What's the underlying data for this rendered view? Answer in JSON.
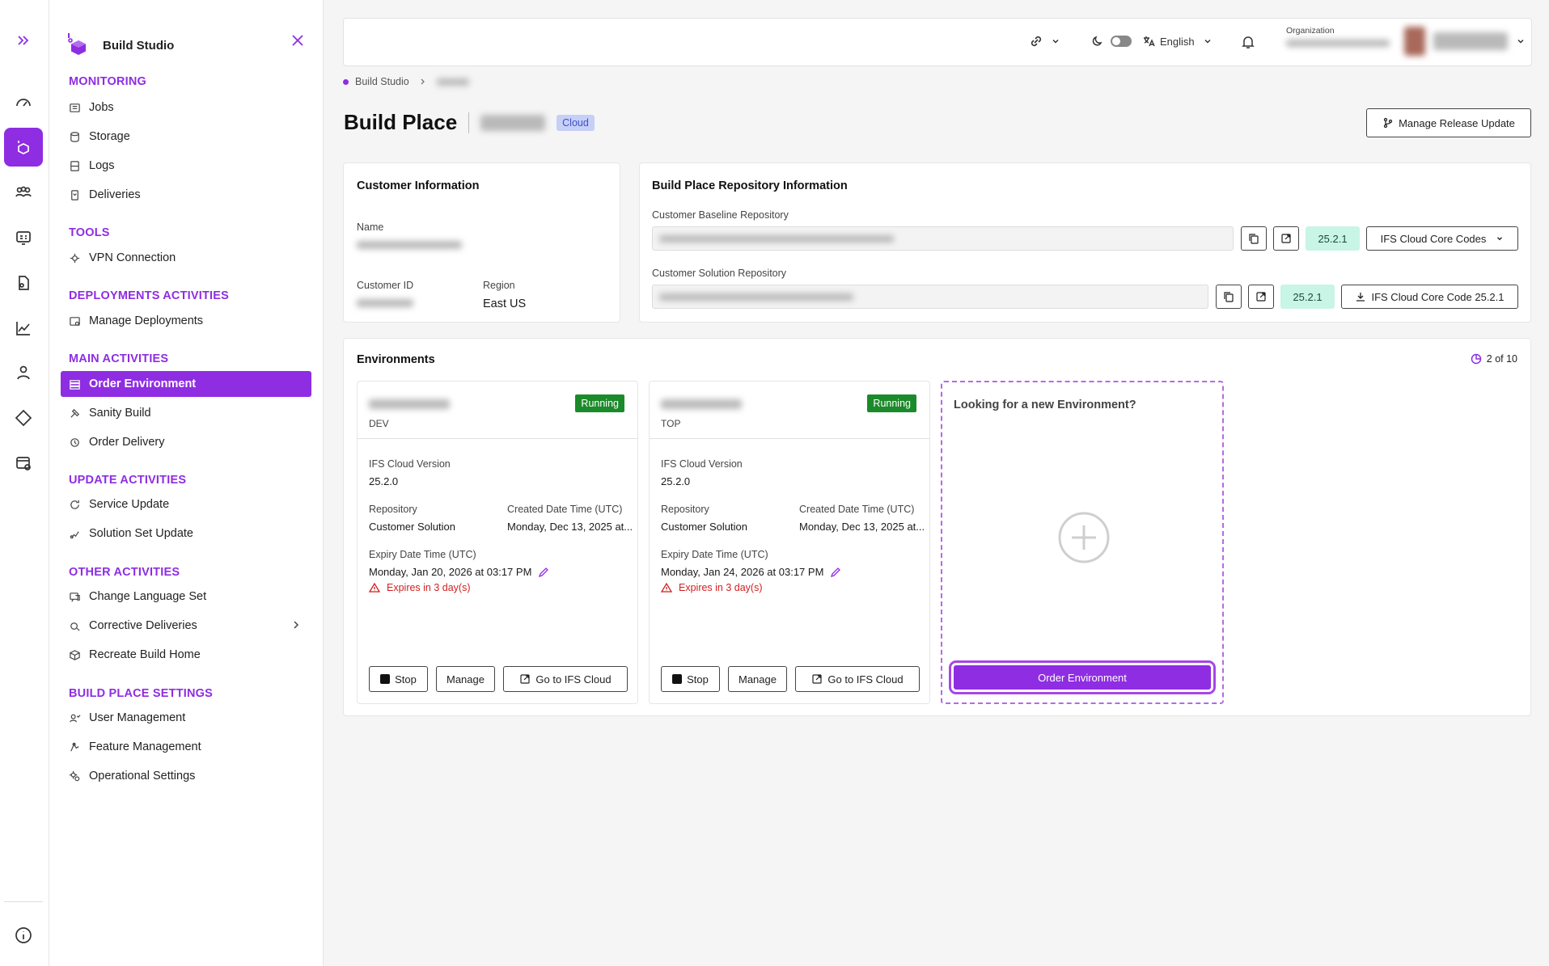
{
  "brand": {
    "title": "Build Studio"
  },
  "sidebar": {
    "sections": [
      {
        "title": "MONITORING",
        "items": [
          "Jobs",
          "Storage",
          "Logs",
          "Deliveries"
        ]
      },
      {
        "title": "TOOLS",
        "items": [
          "VPN Connection"
        ]
      },
      {
        "title": "DEPLOYMENTS ACTIVITIES",
        "items": [
          "Manage Deployments"
        ]
      },
      {
        "title": "MAIN ACTIVITIES",
        "items": [
          "Order Environment",
          "Sanity Build",
          "Order Delivery"
        ]
      },
      {
        "title": "UPDATE ACTIVITIES",
        "items": [
          "Service Update",
          "Solution Set Update"
        ]
      },
      {
        "title": "OTHER ACTIVITIES",
        "items": [
          "Change Language Set",
          "Corrective Deliveries",
          "Recreate Build Home"
        ]
      },
      {
        "title": "BUILD PLACE SETTINGS",
        "items": [
          "User Management",
          "Feature Management",
          "Operational Settings"
        ]
      }
    ],
    "active_item": "Order Environment"
  },
  "topbar": {
    "language": "English",
    "org_label": "Organization"
  },
  "breadcrumb": {
    "root": "Build Studio"
  },
  "page": {
    "title": "Build Place",
    "badge": "Cloud",
    "manage_release_label": "Manage Release Update"
  },
  "customer": {
    "heading": "Customer Information",
    "name_label": "Name",
    "id_label": "Customer ID",
    "region_label": "Region",
    "region_value": "East US"
  },
  "repo": {
    "heading": "Build Place Repository Information",
    "baseline_label": "Customer Baseline Repository",
    "baseline_version": "25.2.1",
    "baseline_action": "IFS Cloud Core Codes",
    "solution_label": "Customer Solution Repository",
    "solution_version": "25.2.1",
    "solution_action": "IFS Cloud Core Code 25.2.1"
  },
  "environments": {
    "heading": "Environments",
    "count": "2 of 10",
    "cards": [
      {
        "type": "DEV",
        "status": "Running",
        "version_label": "IFS Cloud Version",
        "version": "25.2.0",
        "repo_label": "Repository",
        "repo": "Customer Solution",
        "created_label": "Created Date Time (UTC)",
        "created": "Monday, Dec 13, 2025 at...",
        "expiry_label": "Expiry Date Time (UTC)",
        "expiry": "Monday, Jan 20, 2026 at 03:17 PM",
        "warning": "Expires in 3 day(s)",
        "stop": "Stop",
        "manage": "Manage",
        "goto": "Go to IFS Cloud"
      },
      {
        "type": "TOP",
        "status": "Running",
        "version_label": "IFS Cloud Version",
        "version": "25.2.0",
        "repo_label": "Repository",
        "repo": "Customer Solution",
        "created_label": "Created Date Time (UTC)",
        "created": "Monday, Dec 13, 2025 at...",
        "expiry_label": "Expiry Date Time (UTC)",
        "expiry": "Monday, Jan 24, 2026 at 03:17 PM",
        "warning": "Expires in 3 day(s)",
        "stop": "Stop",
        "manage": "Manage",
        "goto": "Go to IFS Cloud"
      }
    ],
    "new_env": {
      "heading": "Looking for a new Environment?",
      "button": "Order Environment"
    }
  },
  "colors": {
    "accent": "#8e2de2",
    "running": "#1b8a2a",
    "warning": "#d21f1f",
    "version_bg": "#c8f5e6"
  }
}
